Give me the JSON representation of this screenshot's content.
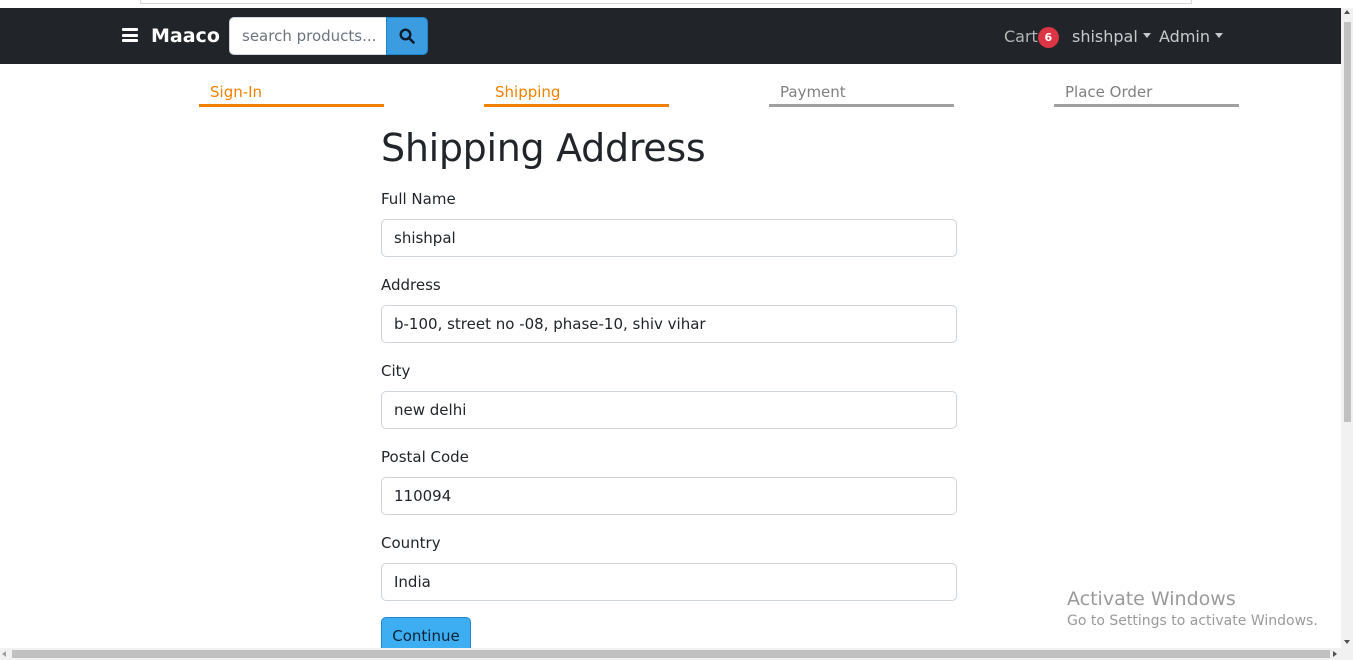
{
  "navbar": {
    "brand": "Maaco",
    "search_placeholder": "search products...",
    "cart_label": "Cart",
    "cart_count": "6",
    "user_menu": "shishpal",
    "admin_menu": "Admin",
    "bg_color": "#212529",
    "accent_color": "#3b9de0",
    "badge_color": "#dc3545"
  },
  "checkout_steps": [
    {
      "label": "Sign-In",
      "active": true
    },
    {
      "label": "Shipping",
      "active": true
    },
    {
      "label": "Payment",
      "active": false
    },
    {
      "label": "Place Order",
      "active": false
    }
  ],
  "step_colors": {
    "active": "#f08000",
    "inactive": "#a0a0a0"
  },
  "form": {
    "title": "Shipping Address",
    "fields": [
      {
        "label": "Full Name",
        "value": "shishpal"
      },
      {
        "label": "Address",
        "value": "b-100, street no -08, phase-10, shiv vihar"
      },
      {
        "label": "City",
        "value": "new delhi"
      },
      {
        "label": "Postal Code",
        "value": "110094"
      },
      {
        "label": "Country",
        "value": "India"
      }
    ],
    "submit_label": "Continue"
  },
  "watermark": {
    "line1": "Activate Windows",
    "line2": "Go to Settings to activate Windows."
  }
}
